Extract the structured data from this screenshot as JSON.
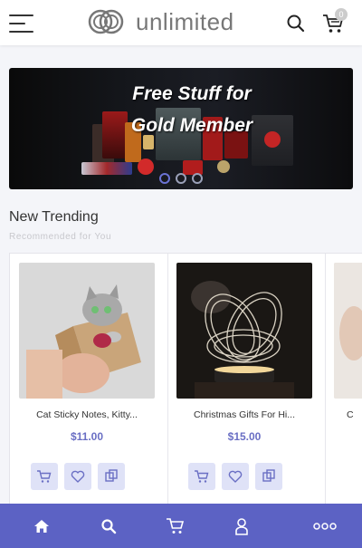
{
  "header": {
    "brand_name": "unlimited",
    "cart_count": "0",
    "icons": [
      "menu-icon",
      "logo-mark-icon",
      "search-icon",
      "cart-icon"
    ]
  },
  "banner": {
    "title_line1": "Free Stuff for",
    "title_line2": "Gold Member",
    "slides": 3,
    "active_slide": 1
  },
  "section": {
    "title": "New Trending",
    "subtitle": "Recommended for You"
  },
  "products": [
    {
      "name": "Cat Sticky Notes, Kitty...",
      "price": "$11.00"
    },
    {
      "name": "Christmas Gifts For Hi...",
      "price": "$15.00"
    },
    {
      "name": "C",
      "price": ""
    }
  ],
  "bottom_nav": {
    "items": [
      "home-icon",
      "search-icon",
      "cart-icon",
      "user-icon",
      "more-icon"
    ]
  },
  "colors": {
    "accent": "#5c62c4",
    "price": "#6a6fc4",
    "action_bg": "#dfe2f7"
  }
}
